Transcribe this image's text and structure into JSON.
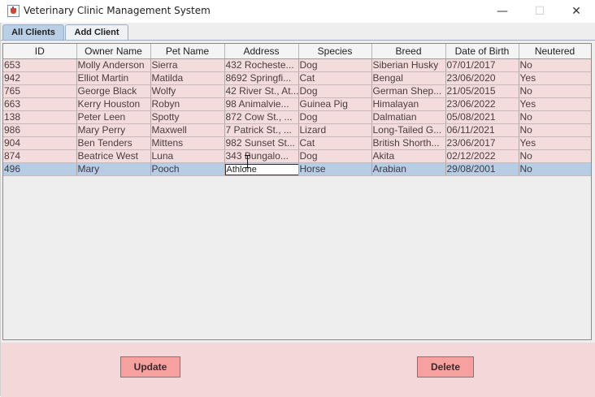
{
  "window": {
    "title": "Veterinary Clinic Management System",
    "controls": {
      "minimize": "—",
      "maximize": "☐",
      "close": "✕"
    },
    "icon": "java-cup-icon"
  },
  "tabs": [
    {
      "label": "All Clients",
      "active": true
    },
    {
      "label": "Add Client",
      "active": false
    }
  ],
  "table": {
    "columns": [
      "ID",
      "Owner Name",
      "Pet Name",
      "Address",
      "Species",
      "Breed",
      "Date of Birth",
      "Neutered"
    ],
    "rows": [
      [
        "653",
        "Molly Anderson",
        "Sierra",
        "432 Rocheste...",
        "Dog",
        "Siberian Husky",
        "07/01/2017",
        "No"
      ],
      [
        "942",
        "Elliot Martin",
        "Matilda",
        "8692 Springfi...",
        "Cat",
        "Bengal",
        "23/06/2020",
        "Yes"
      ],
      [
        "765",
        "George Black",
        "Wolfy",
        "42 River St., At...",
        "Dog",
        "German Shep...",
        "21/05/2015",
        "No"
      ],
      [
        "663",
        "Kerry Houston",
        "Robyn",
        "98 Animalvie...",
        "Guinea Pig",
        "Himalayan",
        "23/06/2022",
        "Yes"
      ],
      [
        "138",
        "Peter Leen",
        "Spotty",
        "872 Cow St., ...",
        "Dog",
        "Dalmatian",
        "05/08/2021",
        "No"
      ],
      [
        "986",
        "Mary Perry",
        "Maxwell",
        "7 Patrick St., ...",
        "Lizard",
        "Long-Tailed G...",
        "06/11/2021",
        "No"
      ],
      [
        "904",
        "Ben Tenders",
        "Mittens",
        "982 Sunset St...",
        "Cat",
        "British Shorth...",
        "23/06/2017",
        "Yes"
      ],
      [
        "874",
        "Beatrice West",
        "Luna",
        "343 Bungalo...",
        "Dog",
        "Akita",
        "02/12/2022",
        "No"
      ],
      [
        "496",
        "Mary",
        "Pooch",
        "Athlone",
        "Horse",
        "Arabian",
        "29/08/2001",
        "No"
      ]
    ],
    "selected_row": 8,
    "editing_cell": {
      "row": 8,
      "column": 3
    }
  },
  "buttons": {
    "update": "Update",
    "delete": "Delete"
  },
  "colors": {
    "row_background": "#f5dcdc",
    "selected_row": "#b7cde3",
    "button_background": "#f6a0a0",
    "bottom_panel": "#f2d8d8"
  }
}
